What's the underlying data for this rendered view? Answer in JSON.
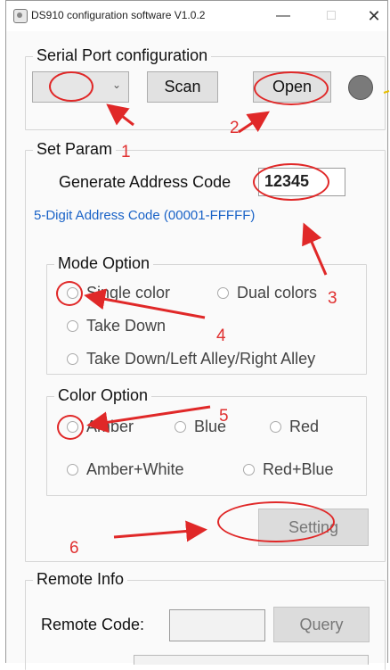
{
  "window": {
    "title": "DS910 configuration software V1.0.2",
    "minimize_glyph": "—",
    "maximize_glyph": "□",
    "close_glyph": "✕"
  },
  "serial": {
    "group_label": "Serial Port configuration",
    "port_value": "",
    "scan_label": "Scan",
    "open_label": "Open",
    "status_color": "#7a7a7a"
  },
  "param": {
    "group_label": "Set Param",
    "address_label": "Generate Address Code",
    "address_value": "12345",
    "address_hint": "5-Digit Address Code (00001-FFFFF)",
    "mode": {
      "group_label": "Mode Option",
      "options": [
        "Single color",
        "Dual colors",
        "Take Down",
        "Take Down/Left Alley/Right Alley"
      ]
    },
    "color": {
      "group_label": "Color Option",
      "options": [
        "Amber",
        "Blue",
        "Red",
        "Amber+White",
        "Red+Blue"
      ]
    },
    "setting_label": "Setting"
  },
  "remote": {
    "group_label": "Remote Info",
    "code_label": "Remote Code:",
    "code_value": "",
    "query_label": "Query"
  },
  "annotations": {
    "color": "#e02828",
    "labels": [
      "1",
      "2",
      "3",
      "4",
      "5",
      "6"
    ]
  }
}
